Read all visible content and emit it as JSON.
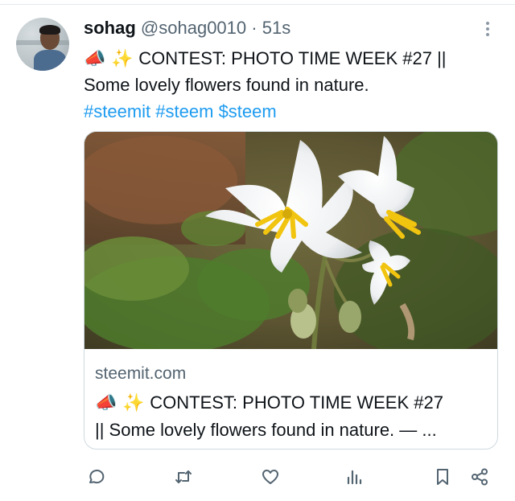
{
  "post": {
    "author_name": "sohag",
    "author_handle": "@sohag0010",
    "separator": "·",
    "time": "51s",
    "emoji_1": "📣",
    "emoji_2": "✨",
    "text_line1": "CONTEST: PHOTO TIME WEEK #27 ||",
    "text_line2": "Some lovely flowers found in nature.",
    "hashtags": [
      "#steemit",
      "#steem",
      "$steem"
    ]
  },
  "card": {
    "domain": "steemit.com",
    "emoji_1": "📣",
    "emoji_2": "✨",
    "title_line1": "CONTEST: PHOTO TIME WEEK #27",
    "title_line2": "|| Some lovely flowers found in nature. — ..."
  },
  "icons": {
    "more": "more-vertical-icon",
    "reply": "reply-icon",
    "repost": "repost-icon",
    "like": "heart-icon",
    "views": "analytics-icon",
    "bookmark": "bookmark-icon",
    "share": "share-icon"
  },
  "colors": {
    "link": "#1d9bf0",
    "text": "#0f1419",
    "muted": "#536471",
    "border": "#cfd9de"
  }
}
